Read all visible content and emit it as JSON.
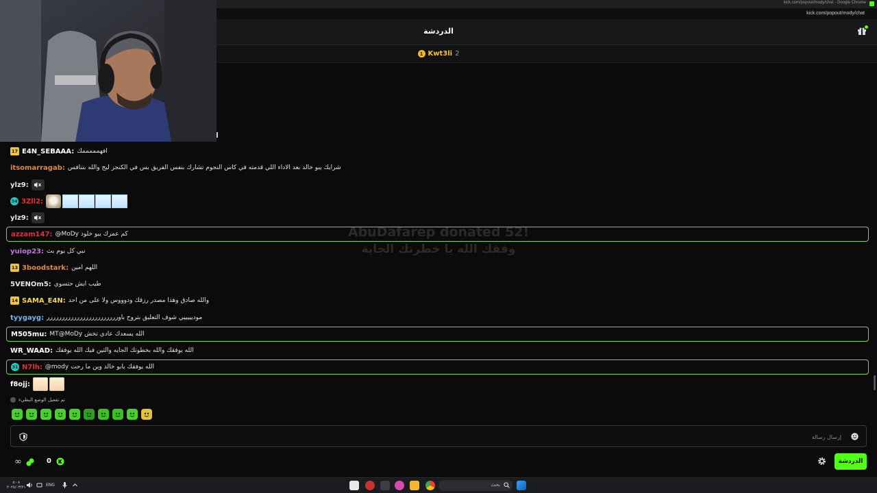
{
  "browser": {
    "window_title": "kick.com/popout/mody/chat - Google Chrome",
    "url": "kick.com/popout/mody/chat"
  },
  "header": {
    "title": "الدردشة"
  },
  "pinned": {
    "badge": "1",
    "name": "Kwt3li",
    "count": "2"
  },
  "watermark": {
    "line1": "AbuDafarep donated 52!",
    "line2": "وفقك الله يا خطرتك الجاية"
  },
  "messages": [
    {
      "badge": "17",
      "badge_type": "gold",
      "user": "E4N_SEBAAA:",
      "user_color": "#ffffff",
      "text": "افهمممممك",
      "highlight": false
    },
    {
      "badge": "",
      "badge_type": "",
      "user": "itsomarragab:",
      "user_color": "#e58a3a",
      "text": "شرايك يبو خالد بعد الاداء اللي قدمته في كاس النجوم تشارك بنفس الفريق بس في الكنجز ليج والله بتنافس",
      "highlight": false
    },
    {
      "badge": "",
      "badge_type": "",
      "user": "ylz9:",
      "user_color": "#e6e6e6",
      "text": "",
      "mute": true,
      "highlight": false
    },
    {
      "badge": "34",
      "badge_type": "teal",
      "user": "3Zll2:",
      "user_color": "#e0303a",
      "text": "",
      "emotes": [
        "pug",
        "ice",
        "ice",
        "ice",
        "ice"
      ],
      "highlight": false
    },
    {
      "badge": "",
      "badge_type": "",
      "user": "ylz9:",
      "user_color": "#e6e6e6",
      "text": "",
      "mute": true,
      "highlight": false
    },
    {
      "badge": "",
      "badge_type": "",
      "user": "azzam147:",
      "user_color": "#e0303a",
      "text": "@MoDy كم عمرك يبو خلود",
      "highlight": true
    },
    {
      "badge": "",
      "badge_type": "",
      "user": "yuiop23:",
      "user_color": "#c773e8",
      "text": "نبي كل يوم بث",
      "highlight": false
    },
    {
      "badge": "13",
      "badge_type": "gold",
      "user": "3boodstark:",
      "user_color": "#e58a3a",
      "text": "اللهم امين",
      "highlight": false
    },
    {
      "badge": "",
      "badge_type": "",
      "user": "5VENOm5:",
      "user_color": "#e6e6e6",
      "text": "طيب ايش حتسوي",
      "highlight": false
    },
    {
      "badge": "14",
      "badge_type": "gold",
      "user": "SAMA_E4N:",
      "user_color": "#f5d44a",
      "text": "والله صادق وهذا مصدر رزقك ودوووس ولا على من احد",
      "highlight": false
    },
    {
      "badge": "",
      "badge_type": "",
      "user": "tyygayg:",
      "user_color": "#7fb0e6",
      "text": "موديييييي شوف التعليق بتروح باورررررررررررررررررررررررر",
      "highlight": false
    },
    {
      "badge": "",
      "badge_type": "",
      "user": "M505mu:",
      "user_color": "#ffffff",
      "text": "MT@MoDy الله يسعدك عادي تخش",
      "highlight": true
    },
    {
      "badge": "",
      "badge_type": "",
      "user": "WR_WAAD:",
      "user_color": "#ffffff",
      "text": "الله يوفقك والله بخطوتك الجايه والثين فيك الله يوفقك",
      "highlight": false
    },
    {
      "badge": "31",
      "badge_type": "teal",
      "user": "N7lh:",
      "user_color": "#e0303a",
      "text": "@mody الله يوفقك يابو خالد وين ما رحت",
      "highlight": true
    },
    {
      "badge": "",
      "badge_type": "",
      "user": "f8ojj:",
      "user_color": "#ffffff",
      "text": "",
      "emotes": [
        "girl",
        "girl"
      ],
      "highlight": false
    }
  ],
  "slow_mode_note": "تم تفعيل الوضع البطيء",
  "emote_bar": [
    "e1",
    "e2",
    "e3",
    "e4",
    "e5",
    "e6",
    "e7",
    "e8",
    "e9",
    "e10"
  ],
  "input": {
    "placeholder": "إرسال رسالة"
  },
  "footer": {
    "infinity": "∞",
    "count": "0",
    "chat_button": "الدردشة"
  },
  "taskbar": {
    "time": "٥:٠٨",
    "date": "٢٠٢٥/٠٣/٢١",
    "lang": "ENG",
    "search": "بحث"
  },
  "colors": {
    "accent": "#53fc18",
    "background": "#0b0b0c",
    "highlight_border": "#7bd83f"
  }
}
